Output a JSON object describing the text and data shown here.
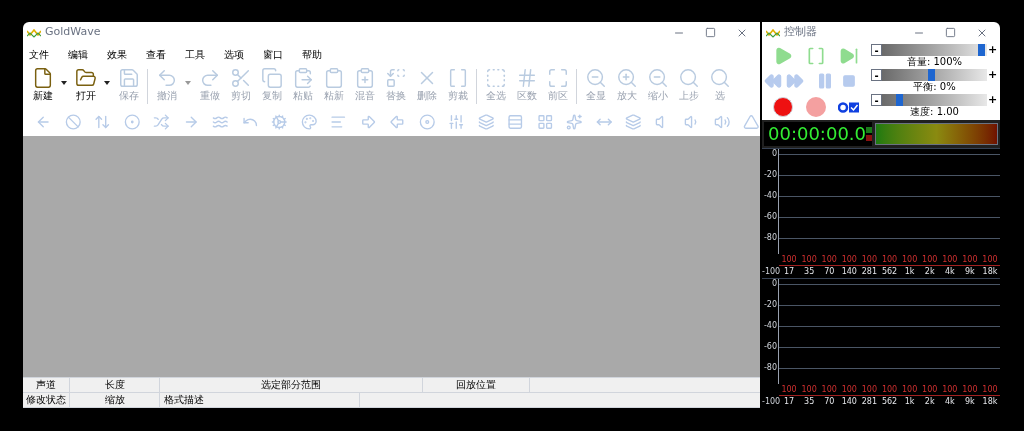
{
  "main_window": {
    "title": "GoldWave",
    "menu": [
      "文件",
      "编辑",
      "效果",
      "查看",
      "工具",
      "选项",
      "窗口",
      "帮助"
    ],
    "toolbar": [
      {
        "kind": "button",
        "label": "新建",
        "disabled": false,
        "dropdown": true
      },
      {
        "kind": "button",
        "label": "打开",
        "disabled": false,
        "dropdown": true
      },
      {
        "kind": "button",
        "label": "保存",
        "disabled": true,
        "dropdown": false
      },
      {
        "kind": "separator"
      },
      {
        "kind": "button",
        "label": "撤消",
        "disabled": true,
        "dropdown": true
      },
      {
        "kind": "button",
        "label": "重做",
        "disabled": true,
        "dropdown": false
      },
      {
        "kind": "button",
        "label": "剪切",
        "disabled": true,
        "dropdown": false
      },
      {
        "kind": "button",
        "label": "复制",
        "disabled": true,
        "dropdown": false
      },
      {
        "kind": "button",
        "label": "粘贴",
        "disabled": true,
        "dropdown": false
      },
      {
        "kind": "button",
        "label": "粘新",
        "disabled": true,
        "dropdown": false
      },
      {
        "kind": "button",
        "label": "混音",
        "disabled": true,
        "dropdown": false
      },
      {
        "kind": "button",
        "label": "替换",
        "disabled": true,
        "dropdown": false
      },
      {
        "kind": "button",
        "label": "删除",
        "disabled": true,
        "dropdown": false
      },
      {
        "kind": "button",
        "label": "剪裁",
        "disabled": true,
        "dropdown": false
      },
      {
        "kind": "separator"
      },
      {
        "kind": "button",
        "label": "全选",
        "disabled": true,
        "dropdown": false
      },
      {
        "kind": "button",
        "label": "区数",
        "disabled": true,
        "dropdown": false
      },
      {
        "kind": "button",
        "label": "前区",
        "disabled": true,
        "dropdown": false
      },
      {
        "kind": "separator"
      },
      {
        "kind": "button",
        "label": "全显",
        "disabled": true,
        "dropdown": false
      },
      {
        "kind": "button",
        "label": "放大",
        "disabled": true,
        "dropdown": false
      },
      {
        "kind": "button",
        "label": "缩小",
        "disabled": true,
        "dropdown": false
      },
      {
        "kind": "button",
        "label": "上步",
        "disabled": true,
        "dropdown": false
      },
      {
        "kind": "button",
        "label": "选",
        "disabled": true,
        "dropdown": false
      }
    ],
    "status_bar": [
      [
        "声道",
        "长度",
        "选定部分范围",
        "回放位置"
      ],
      [
        "修改状态",
        "缩放",
        "格式描述"
      ]
    ]
  },
  "controller": {
    "title": "控制器",
    "sliders": [
      {
        "minus": "-",
        "plus": "+",
        "level": 0.98,
        "reading": "音量: 100%"
      },
      {
        "minus": "-",
        "plus": "+",
        "level": 0.5,
        "reading": "平衡: 0%"
      },
      {
        "minus": "-",
        "plus": "+",
        "level": 0.2,
        "reading": "速度: 1.00"
      }
    ],
    "time": "00:00:00.0",
    "spectra": [
      {
        "yticks": [
          "0",
          "-20",
          "-40",
          "-60",
          "-80",
          "-100"
        ],
        "peaks": [
          "100",
          "100",
          "100",
          "100",
          "100",
          "100",
          "100",
          "100",
          "100",
          "100",
          "100"
        ],
        "xlabels": [
          "17",
          "35",
          "70",
          "140",
          "281",
          "562",
          "1k",
          "2k",
          "4k",
          "9k",
          "18k"
        ]
      },
      {
        "yticks": [
          "0",
          "-20",
          "-40",
          "-60",
          "-80",
          "-100"
        ],
        "peaks": [
          "100",
          "100",
          "100",
          "100",
          "100",
          "100",
          "100",
          "100",
          "100",
          "100",
          "100"
        ],
        "xlabels": [
          "17",
          "35",
          "70",
          "140",
          "281",
          "562",
          "1k",
          "2k",
          "4k",
          "9k",
          "18k"
        ]
      }
    ]
  }
}
